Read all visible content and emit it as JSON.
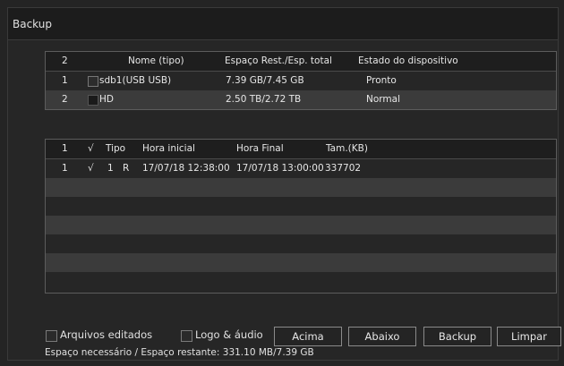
{
  "window": {
    "title": "Backup"
  },
  "devices": {
    "header": {
      "index": "2",
      "name": "Nome (tipo)",
      "space": "Espaço Rest./Esp. total",
      "state": "Estado do dispositivo"
    },
    "rows": [
      {
        "index": "1",
        "name": "sdb1(USB USB)",
        "space": "7.39 GB/7.45 GB",
        "state": "Pronto"
      },
      {
        "index": "2",
        "name": "HD",
        "space": "2.50 TB/2.72 TB",
        "state": "Normal"
      }
    ]
  },
  "files": {
    "header": {
      "index": "1",
      "check": "√",
      "type": "Tipo",
      "start": "Hora inicial",
      "end": "Hora Final",
      "size": "Tam.(KB)"
    },
    "rows": [
      {
        "index": "1",
        "check": "√",
        "channel": "1",
        "type": "R",
        "start": "17/07/18 12:38:00",
        "end": "17/07/18 13:00:00",
        "size": "337702"
      }
    ]
  },
  "options": {
    "edited_files_label": "Arquivos editados",
    "log_audio_label": "Logo & áudio"
  },
  "buttons": {
    "up": "Acima",
    "down": "Abaixo",
    "backup": "Backup",
    "clear": "Limpar"
  },
  "status": {
    "label": "Espaço necessário / Espaço restante:",
    "value": "331.10 MB/7.39 GB"
  }
}
